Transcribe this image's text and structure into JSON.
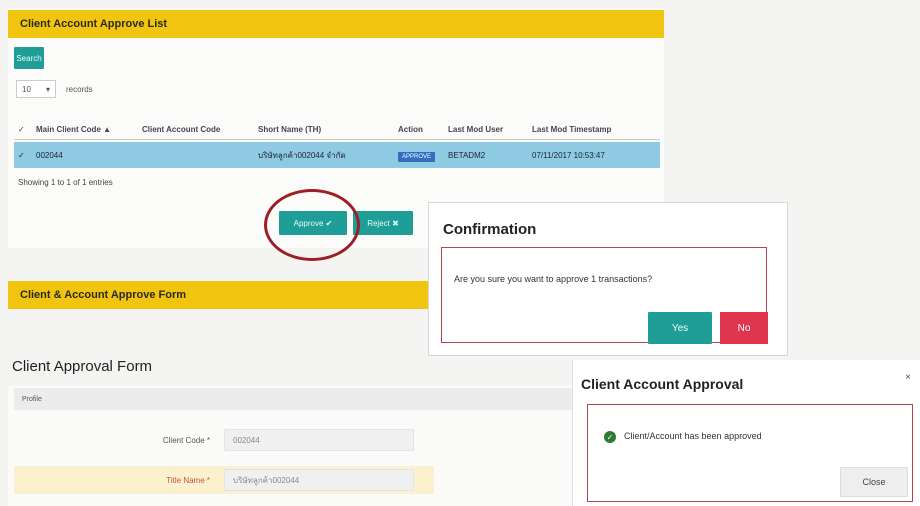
{
  "list_panel": {
    "title": "Client Account Approve List",
    "search_label": "Search",
    "page_size": "10",
    "records_label": "records",
    "columns": [
      "Main Client Code ▲",
      "Client Account Code",
      "Short Name (TH)",
      "Action",
      "Last Mod User",
      "Last Mod Timestamp"
    ],
    "row": {
      "check": "✓",
      "main_client_code": "002044",
      "client_account_code": "",
      "short_name": "บริษัทลูกค้า002044 จำกัด",
      "action": "APPROVE",
      "last_mod_user": "BETADM2",
      "last_mod_timestamp": "07/11/2017 10:53:47"
    },
    "showing": "Showing 1 to 1 of 1 entries",
    "approve_label": "Approve ✔",
    "reject_label": "Reject ✖"
  },
  "confirm_dialog": {
    "title": "Confirmation",
    "message": "Are you sure you want to approve 1 transactions?",
    "yes_label": "Yes",
    "no_label": "No"
  },
  "form_panel": {
    "bar_title": "Client & Account Approve Form",
    "form_title": "Client Approval Form",
    "section": "Profile",
    "fields": [
      {
        "label": "Client Code *",
        "value": "002044"
      },
      {
        "label": "Title Name *",
        "value": "บริษัทลูกค้า002044"
      }
    ]
  },
  "approval_dialog": {
    "title": "Client Account Approval",
    "close_symbol": "×",
    "message": "Client/Account has been approved",
    "close_label": "Close"
  },
  "colors": {
    "gold": "#f1c40f",
    "teal": "#1e9e97",
    "selected_row": "#8ecbe3",
    "danger": "#e0354f",
    "highlight_circle": "#9c1f26"
  },
  "icons": [
    "sort-asc-icon",
    "dropdown-arrow-icon",
    "check-icon",
    "close-x-icon",
    "success-check-icon"
  ]
}
